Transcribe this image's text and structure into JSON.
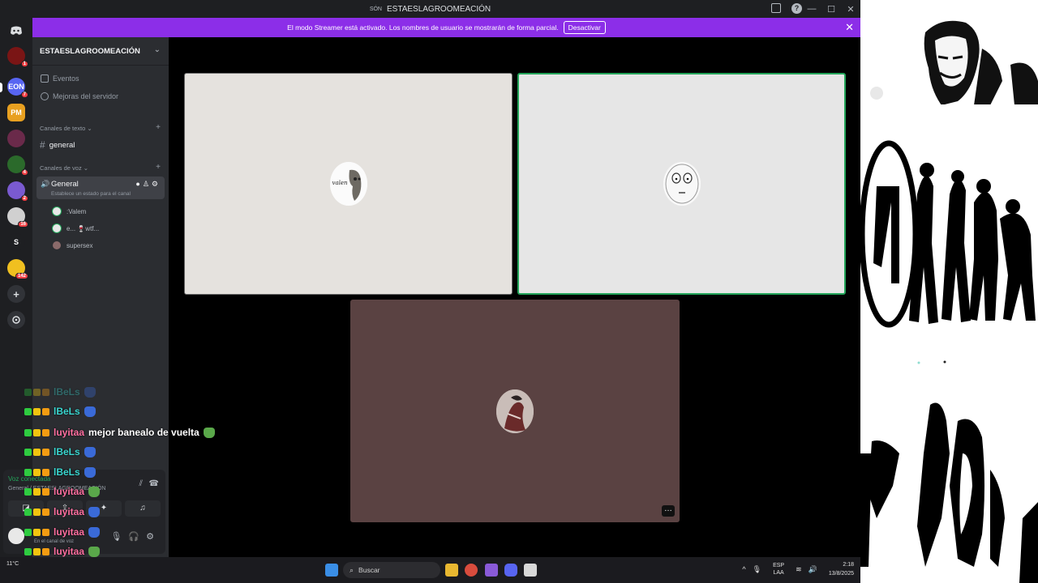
{
  "window": {
    "title": "ESTAESLAGROOMEACIÓN",
    "title_badge": "SÓN",
    "controls": [
      "—",
      "☐",
      "✕"
    ]
  },
  "banner": {
    "text": "El modo Streamer está activado. Los nombres de usuario se mostrarán de forma parcial.",
    "button": "Desactivar",
    "close": "✕"
  },
  "rail": {
    "servers": [
      {
        "label": "",
        "color": "#7a1515",
        "badge": "1"
      },
      {
        "label": "EON",
        "color": "#5865f2",
        "badge": "7"
      },
      {
        "label": "PM",
        "color": "#e8a020",
        "badge": ""
      },
      {
        "label": "",
        "color": "#6a2a4a",
        "badge": ""
      },
      {
        "label": "",
        "color": "#2b6a2b",
        "badge": "4"
      },
      {
        "label": "",
        "color": "#7a5ad0",
        "badge": "2"
      },
      {
        "label": "",
        "color": "#d0d0d0",
        "badge": "16"
      },
      {
        "label": "S",
        "color": "#1e1f22",
        "badge": ""
      },
      {
        "label": "",
        "color": "#f0c020",
        "badge": "142"
      }
    ],
    "discord_icon": "discord-logo",
    "add_icon": "+",
    "discover_icon": "compass"
  },
  "sidebar": {
    "server_name": "ESTAESLAGROOMEACIÓN",
    "nav": [
      "Eventos",
      "Mejoras del servidor"
    ],
    "text_category": "Canales de texto",
    "text_channel": "general",
    "voice_category": "Canales de voz",
    "voice_channel": "General",
    "voice_status": "Establece un estado para el canal",
    "members": [
      ":Valem",
      "e... 🍷wtf...",
      "supersex"
    ]
  },
  "voice_panel": {
    "connected": "Voz conectada",
    "where": "General / ESTAESLAGROOMEACIÓN",
    "user_sub": "En el canal de voz"
  },
  "stage": {
    "tile1_avatar_text": "valen"
  },
  "chat": {
    "messages": [
      {
        "nick": "lBeLs",
        "color": "#3ad6d0",
        "text": ""
      },
      {
        "nick": "lBeLs",
        "color": "#3ad6d0",
        "text": ""
      },
      {
        "nick": "luyitaa",
        "color": "#ff6fa0",
        "text": "mejor banealo de vuelta"
      },
      {
        "nick": "lBeLs",
        "color": "#3ad6d0",
        "text": ""
      },
      {
        "nick": "lBeLs",
        "color": "#3ad6d0",
        "text": ""
      },
      {
        "nick": "luyitaa",
        "color": "#ff6fa0",
        "text": ""
      },
      {
        "nick": "luyitaa",
        "color": "#ff6fa0",
        "text": ""
      },
      {
        "nick": "luyitaa",
        "color": "#ff6fa0",
        "text": ""
      },
      {
        "nick": "luyitaa",
        "color": "#ff6fa0",
        "text": ""
      },
      {
        "nick": "luyitaa",
        "color": "#ff6fa0",
        "text": ""
      }
    ]
  },
  "taskbar": {
    "search": "Buscar",
    "weather": "11°C",
    "lang_top": "ESP",
    "lang_bottom": "LAA",
    "time": "2:18",
    "date": "13/8/2025"
  },
  "colors": {
    "accent": "#8c2ee8",
    "online": "#23a55a"
  }
}
